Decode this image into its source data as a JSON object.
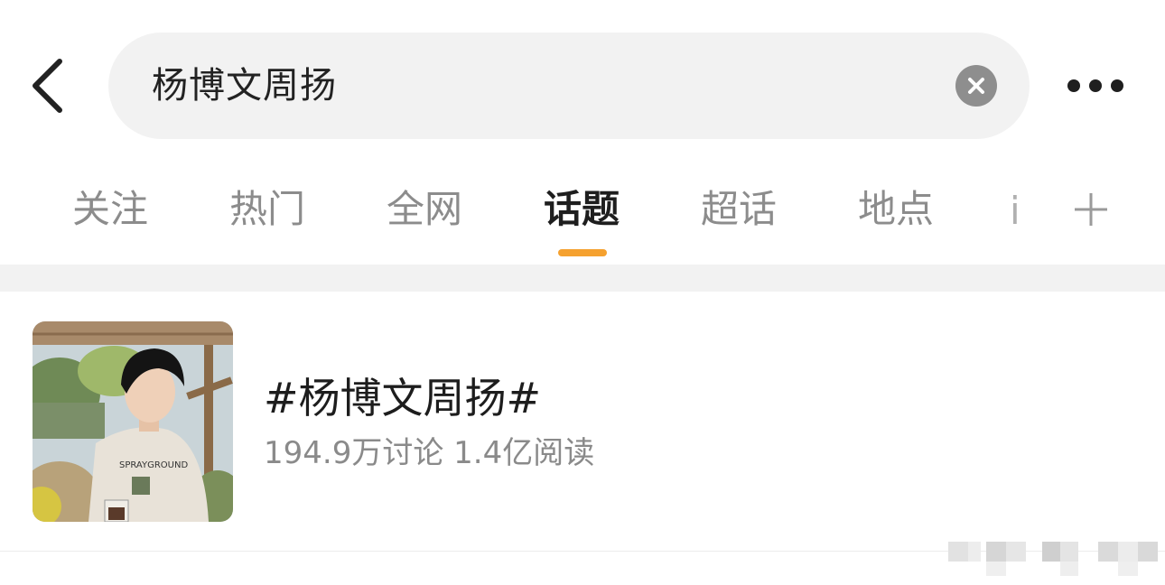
{
  "search": {
    "query": "杨博文周扬"
  },
  "tabs": [
    {
      "label": "关注",
      "active": false
    },
    {
      "label": "热门",
      "active": false
    },
    {
      "label": "全网",
      "active": false
    },
    {
      "label": "话题",
      "active": true
    },
    {
      "label": "超话",
      "active": false
    },
    {
      "label": "地点",
      "active": false
    }
  ],
  "icons": {
    "back": "chevron-left-icon",
    "clear": "close-circle-icon",
    "more": "more-horizontal-icon",
    "add_tab": "plus-icon"
  },
  "colors": {
    "accent": "#f5a12f",
    "search_bg": "#f2f2f2",
    "tab_inactive": "#8c8c8c",
    "tab_active": "#1e1e1e"
  },
  "result": {
    "title": "#杨博文周扬#",
    "stats": "194.9万讨论 1.4亿阅读",
    "thumb_shirt_text": "SPRAYGROUND"
  }
}
